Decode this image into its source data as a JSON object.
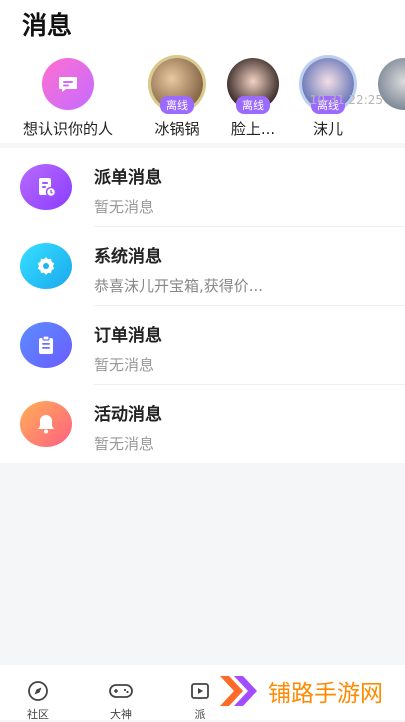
{
  "header": {
    "title": "消息"
  },
  "people": [
    {
      "name": "想认识你的人"
    },
    {
      "name": "冰锅锅",
      "status": "离线"
    },
    {
      "name": "脸上...",
      "status": "离线"
    },
    {
      "name": "沫儿",
      "status": "离线"
    }
  ],
  "messages": [
    {
      "title": "派单消息",
      "subtitle": "暂无消息"
    },
    {
      "title": "系统消息",
      "subtitle": "恭喜沫儿开宝箱,获得价...",
      "time": "10-31 22:25"
    },
    {
      "title": "订单消息",
      "subtitle": "暂无消息"
    },
    {
      "title": "活动消息",
      "subtitle": "暂无消息"
    }
  ],
  "nav": [
    {
      "label": "社区",
      "icon": "compass-icon"
    },
    {
      "label": "大神",
      "icon": "gamepad-icon"
    },
    {
      "label": "派",
      "icon": "dispatch-icon"
    }
  ],
  "watermark": {
    "text": "铺路手游网"
  },
  "colors": {
    "accent": "#9b6bff",
    "watermark": "#ff8a00"
  }
}
